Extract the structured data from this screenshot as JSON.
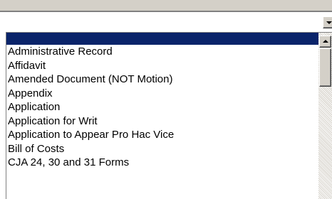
{
  "dropdown": {
    "selected_value": ""
  },
  "listbox": {
    "selected_item": "",
    "items": [
      "Administrative Record",
      "Affidavit",
      "Amended Document (NOT Motion)",
      "Appendix",
      "Application",
      "Application for Writ",
      "Application to Appear Pro Hac Vice",
      "Bill of Costs",
      "CJA 24, 30 and 31 Forms"
    ]
  },
  "icons": {
    "dropdown_arrow": "chevron-down-icon",
    "scroll_up": "chevron-up-icon"
  },
  "colors": {
    "selection": "#0a246a",
    "chrome": "#d4d0c8"
  }
}
